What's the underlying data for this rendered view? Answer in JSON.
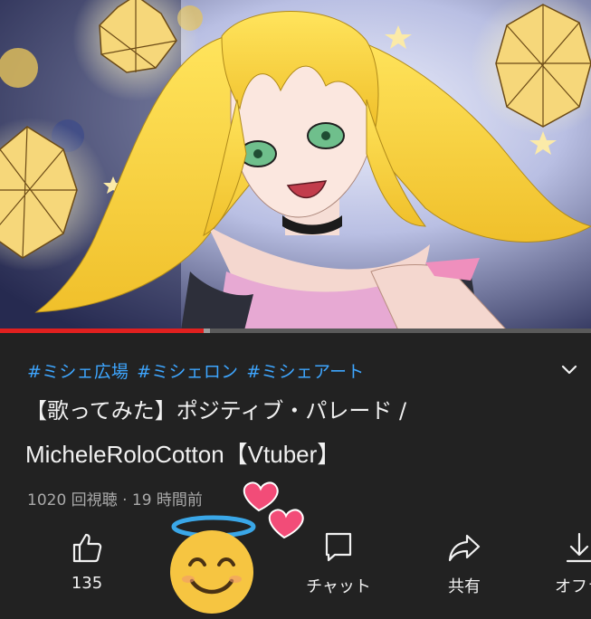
{
  "video": {
    "thumbnail_icon": "anime-illustration-blonde-girl",
    "progress_fraction": 0.345,
    "buffer_fraction": 0.355
  },
  "hashtags": [
    "#ミシェ広場",
    "#ミシェロン",
    "#ミシェアート"
  ],
  "title": {
    "line1": "【歌ってみた】ポジティブ・パレード /",
    "line2": "MicheleRoloCotton【Vtuber】"
  },
  "stats": {
    "text": "1020 回視聴 · 19 時間前"
  },
  "actions": {
    "like": {
      "icon": "thumbs-up-icon",
      "label": "135"
    },
    "chat": {
      "icon": "chat-bubble-icon",
      "label": "チャット"
    },
    "share": {
      "icon": "share-arrow-icon",
      "label": "共有"
    },
    "offline": {
      "icon": "download-icon",
      "label": "オフラ"
    }
  },
  "overlay": {
    "emoji": "smiling-face-with-halo",
    "hearts": "two-hearts"
  },
  "colors": {
    "background": "#222222",
    "hashtag": "#3ea6ff",
    "progress": "#e0201f",
    "secondary_text": "#aaaaaa"
  }
}
